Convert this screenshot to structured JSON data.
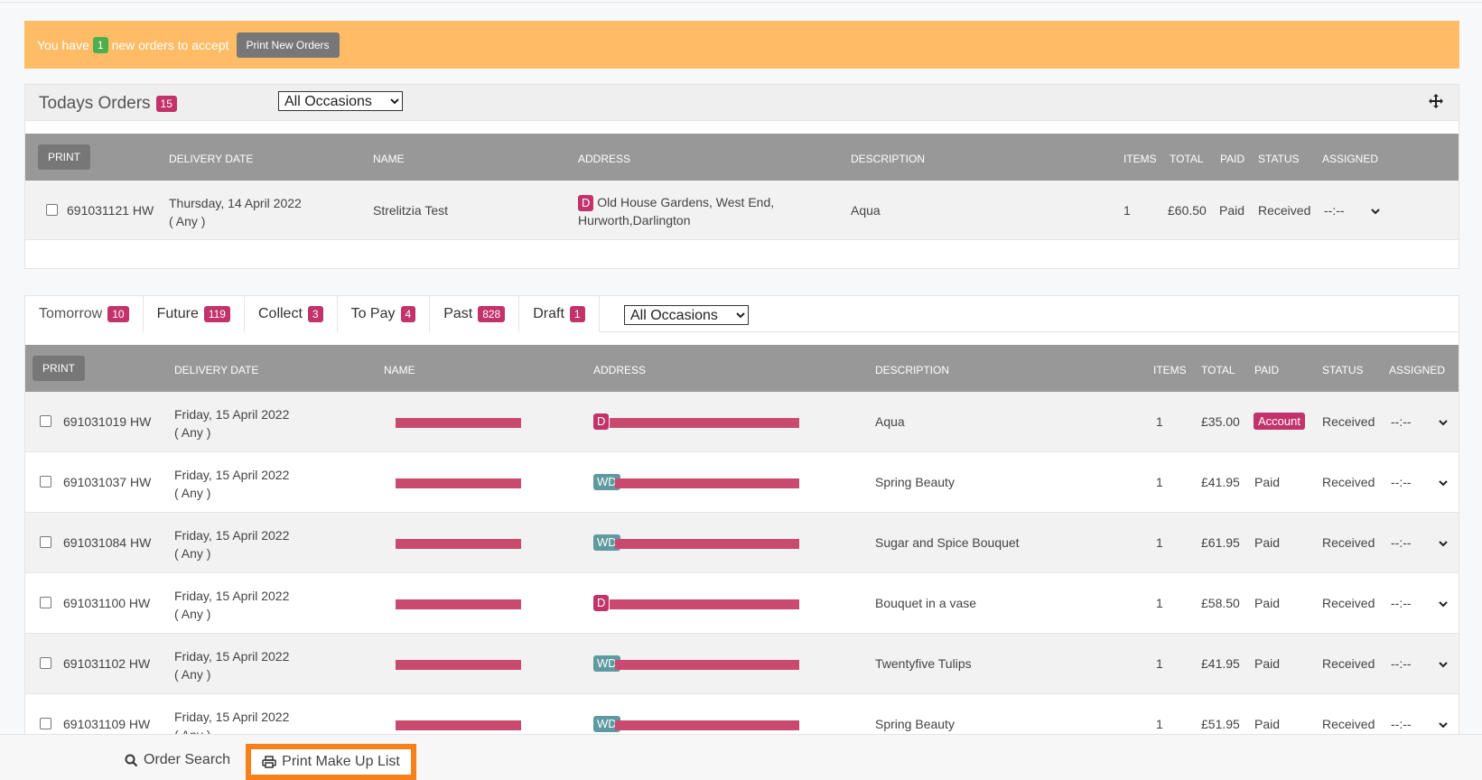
{
  "alert": {
    "prefix": "You have",
    "count": "1",
    "suffix": "new orders to accept",
    "button": "Print New Orders"
  },
  "today": {
    "title": "Todays Orders",
    "count": "15",
    "occasion": "All Occasions",
    "headers": {
      "print": "Print",
      "delivery_date": "DELIVERY DATE",
      "name": "NAME",
      "address": "ADDRESS",
      "description": "DESCRIPTION",
      "items": "ITEMS",
      "total": "TOTAL",
      "paid": "PAID",
      "status": "STATUS",
      "assigned": "ASSIGNED"
    },
    "rows": [
      {
        "order": "691031121 HW",
        "date": "Thursday, 14 April 2022",
        "time": "( Any )",
        "name": "Strelitzia Test",
        "addr_type": "D",
        "address_line1": "Old House Gardens, West End,",
        "address_line2": "Hurworth,Darlington",
        "description": "Aqua",
        "items": "1",
        "total": "£60.50",
        "paid": "Paid",
        "status": "Received",
        "assigned": "--:--"
      }
    ]
  },
  "tabs": [
    {
      "label": "Tomorrow",
      "count": "10"
    },
    {
      "label": "Future",
      "count": "119"
    },
    {
      "label": "Collect",
      "count": "3"
    },
    {
      "label": "To Pay",
      "count": "4"
    },
    {
      "label": "Past",
      "count": "828"
    },
    {
      "label": "Draft",
      "count": "1"
    }
  ],
  "tomorrow": {
    "occasion": "All Occasions",
    "headers": {
      "print": "Print",
      "delivery_date": "DELIVERY DATE",
      "name": "NAME",
      "address": "ADDRESS",
      "description": "DESCRIPTION",
      "items": "ITEMS",
      "total": "TOTAL",
      "paid": "PAID",
      "status": "STATUS",
      "assigned": "ASSIGNED"
    },
    "rows": [
      {
        "order": "691031019 HW",
        "date": "Friday, 15 April 2022",
        "time": "( Any )",
        "addr_type": "D",
        "description": "Aqua",
        "items": "1",
        "total": "£35.00",
        "paid": "Account",
        "status": "Received",
        "assigned": "--:--"
      },
      {
        "order": "691031037 HW",
        "date": "Friday, 15 April 2022",
        "time": "( Any )",
        "addr_type": "WD",
        "description": "Spring Beauty",
        "items": "1",
        "total": "£41.95",
        "paid": "Paid",
        "status": "Received",
        "assigned": "--:--"
      },
      {
        "order": "691031084 HW",
        "date": "Friday, 15 April 2022",
        "time": "( Any )",
        "addr_type": "WD",
        "description": "Sugar and Spice Bouquet",
        "items": "1",
        "total": "£61.95",
        "paid": "Paid",
        "status": "Received",
        "assigned": "--:--"
      },
      {
        "order": "691031100 HW",
        "date": "Friday, 15 April 2022",
        "time": "( Any )",
        "addr_type": "D",
        "description": "Bouquet in a vase",
        "items": "1",
        "total": "£58.50",
        "paid": "Paid",
        "status": "Received",
        "assigned": "--:--"
      },
      {
        "order": "691031102 HW",
        "date": "Friday, 15 April 2022",
        "time": "( Any )",
        "addr_type": "WD",
        "description": "Twentyfive Tulips",
        "items": "1",
        "total": "£41.95",
        "paid": "Paid",
        "status": "Received",
        "assigned": "--:--"
      },
      {
        "order": "691031109 HW",
        "date": "Friday, 15 April 2022",
        "time": "( Any )",
        "addr_type": "WD",
        "description": "Spring Beauty",
        "items": "1",
        "total": "£51.95",
        "paid": "Paid",
        "status": "Received",
        "assigned": "--:--"
      }
    ]
  },
  "footer": {
    "order_search": "Order Search",
    "print_makeup": "Print Make Up List"
  },
  "colors": {
    "banner": "#ffbc66",
    "badge": "#c2326b",
    "wd_badge": "#5f9aa0",
    "header": "#989898",
    "highlight": "#f7801a"
  }
}
